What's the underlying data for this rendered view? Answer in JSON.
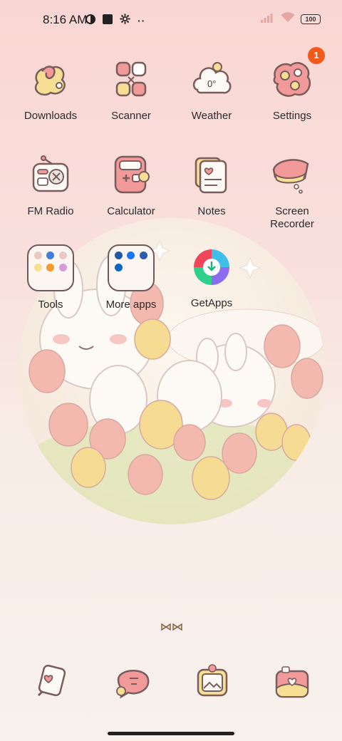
{
  "status_bar": {
    "time": "8:16 AM",
    "battery": "100"
  },
  "apps": [
    {
      "label": "Downloads"
    },
    {
      "label": "Scanner"
    },
    {
      "label": "Weather",
      "temp": "0°"
    },
    {
      "label": "Settings",
      "badge": "1"
    },
    {
      "label": "FM Radio"
    },
    {
      "label": "Calculator"
    },
    {
      "label": "Notes"
    },
    {
      "label": "Screen Recorder"
    }
  ],
  "folders": [
    {
      "label": "Tools"
    },
    {
      "label": "More apps"
    }
  ],
  "getapps": {
    "label": "GetApps"
  },
  "dock": [
    {
      "icon": "phone-icon"
    },
    {
      "icon": "messages-icon"
    },
    {
      "icon": "gallery-icon"
    },
    {
      "icon": "camera-icon"
    }
  ],
  "colors": {
    "badge": "#f25a1b",
    "pink_icon": "#f09a9a",
    "yellow_icon": "#f7df8a"
  }
}
